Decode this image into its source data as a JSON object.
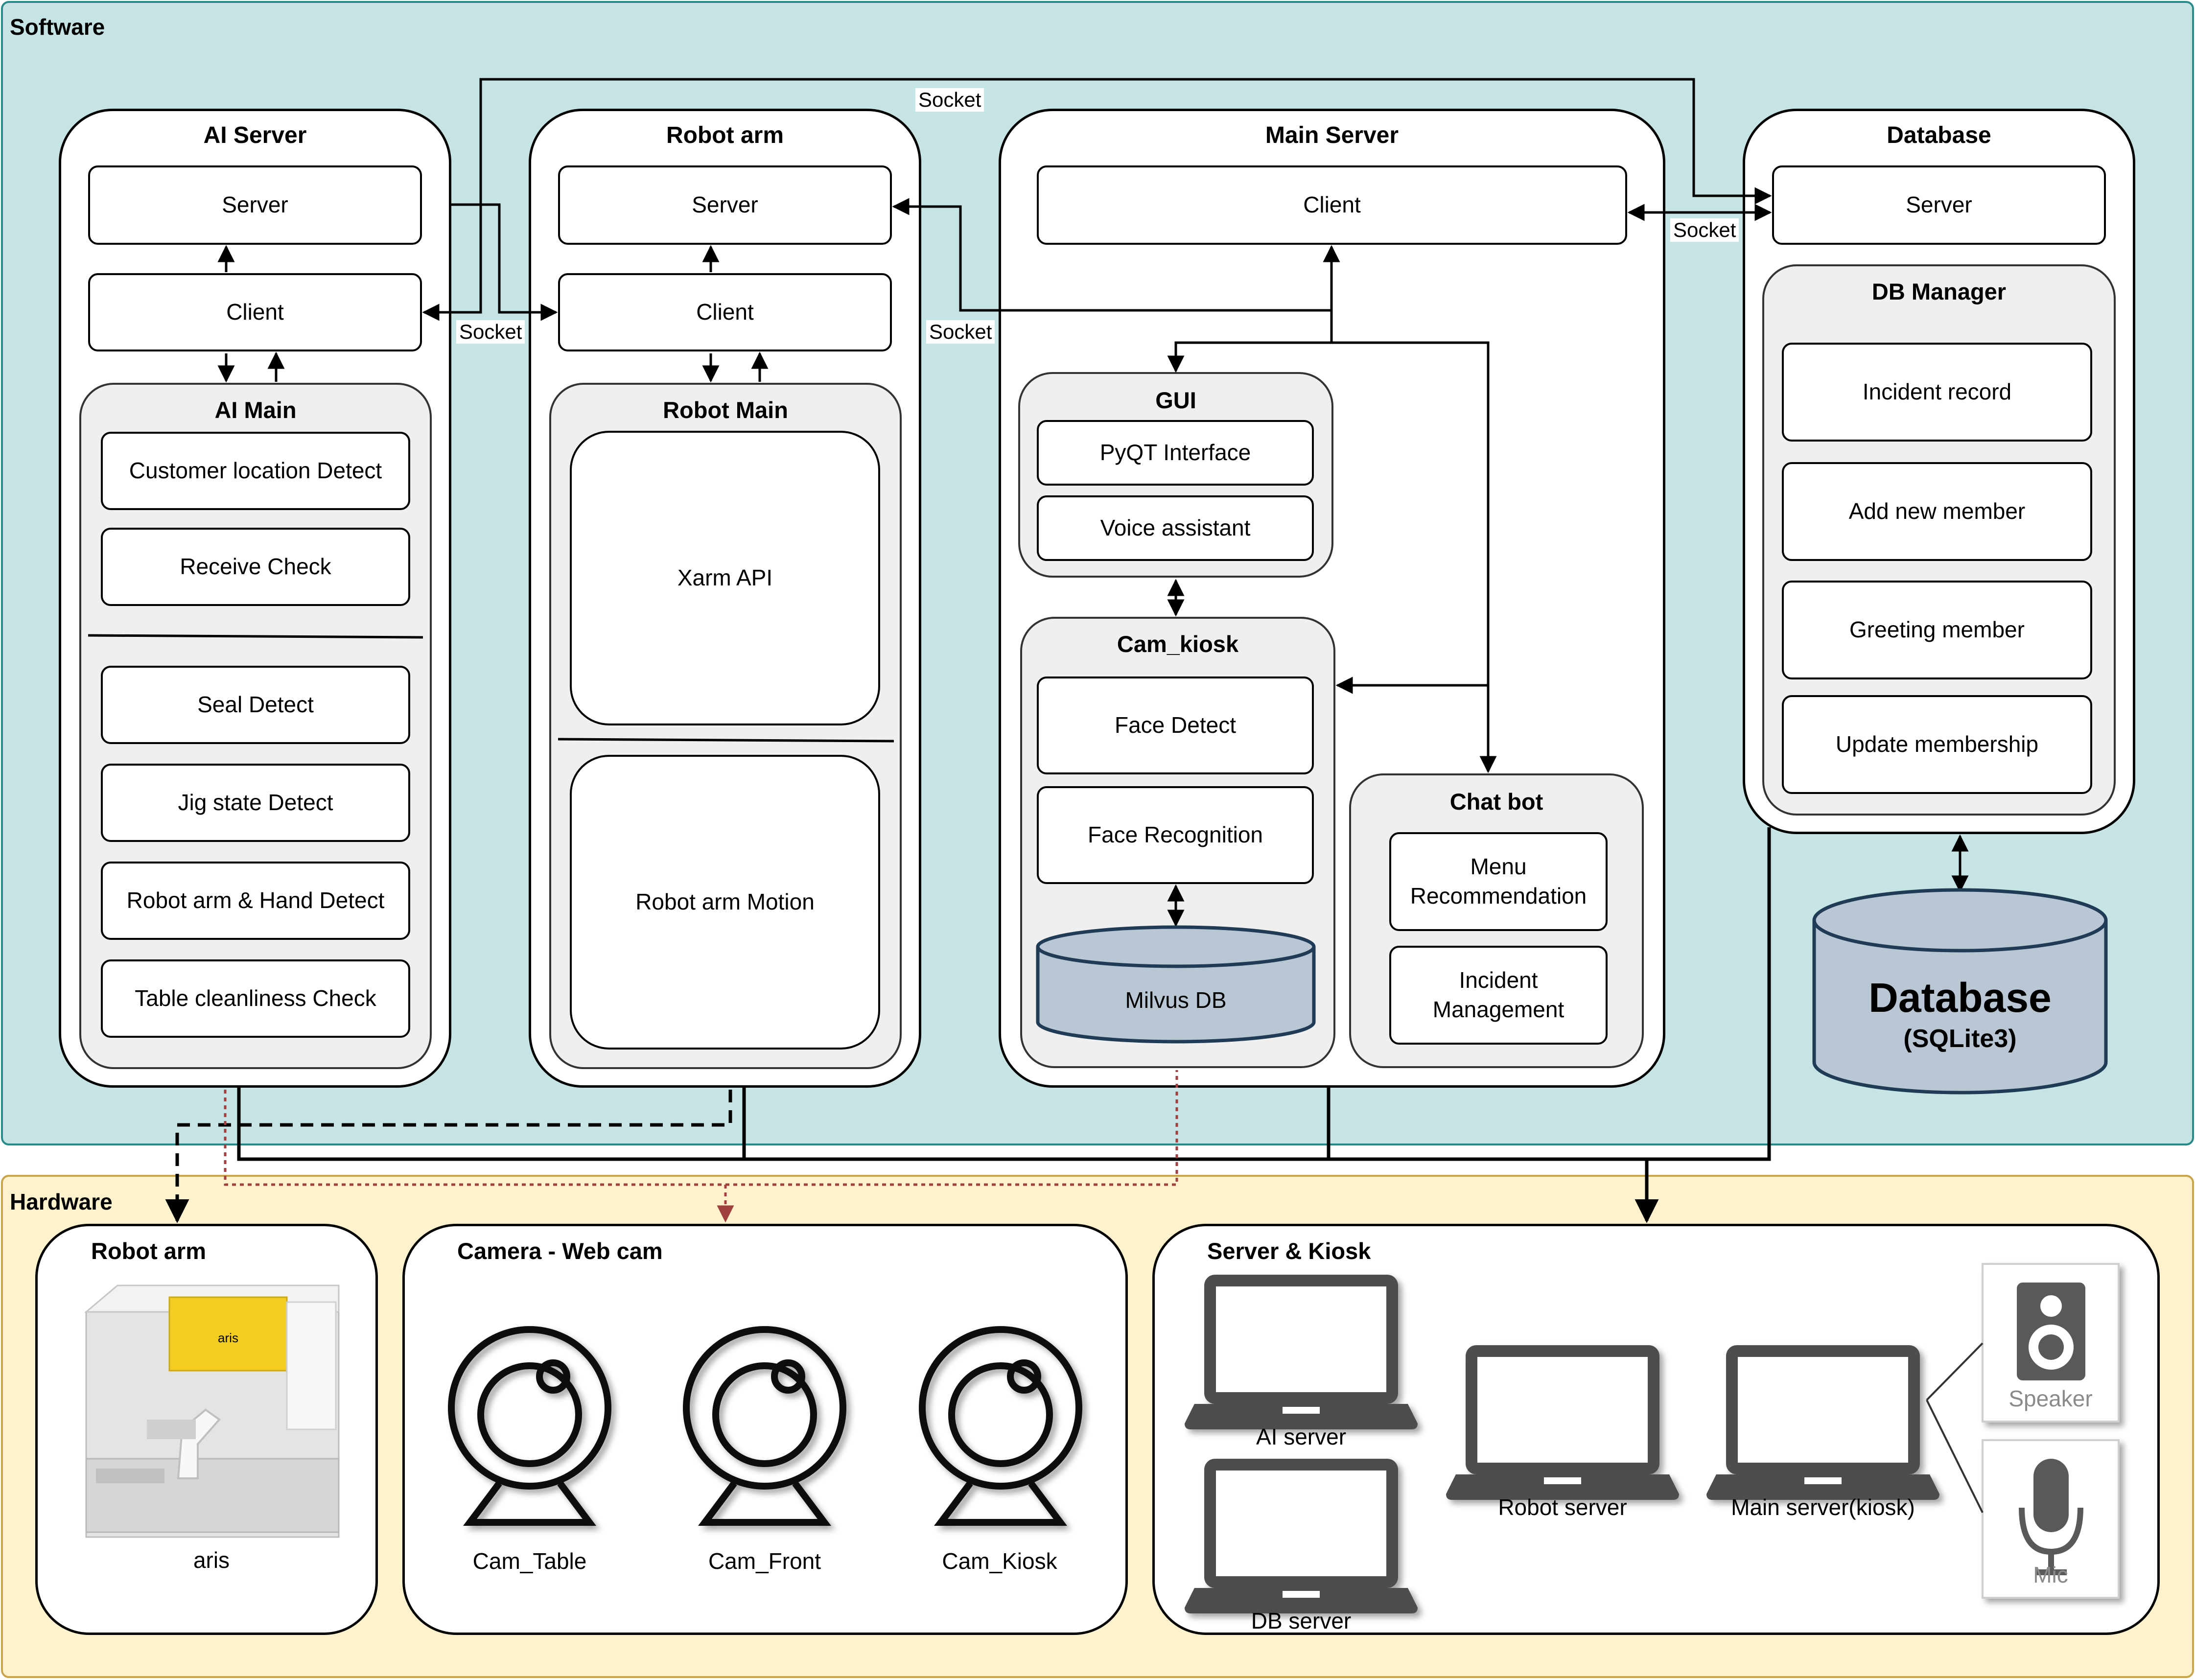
{
  "lanes": {
    "software": "Software",
    "hardware": "Hardware"
  },
  "socket_label": "Socket",
  "ai_server": {
    "title": "AI Server",
    "server": "Server",
    "client": "Client",
    "main_title": "AI Main",
    "items": [
      "Customer location Detect",
      "Receive Check",
      "Seal Detect",
      "Jig state Detect",
      "Robot arm & Hand Detect",
      "Table cleanliness Check"
    ]
  },
  "robot_arm": {
    "title": "Robot arm",
    "server": "Server",
    "client": "Client",
    "main_title": "Robot Main",
    "items": [
      "Xarm API",
      "Robot arm Motion"
    ]
  },
  "main_server": {
    "title": "Main Server",
    "client": "Client",
    "gui_title": "GUI",
    "gui_items": [
      "PyQT Interface",
      "Voice assistant"
    ],
    "cam_title": "Cam_kiosk",
    "cam_items": [
      "Face Detect",
      "Face Recognition"
    ],
    "milvus": "Milvus DB",
    "chatbot_title": "Chat bot",
    "chatbot_items": [
      "Menu Recommendation",
      "Incident Management"
    ]
  },
  "database": {
    "title": "Database",
    "server": "Server",
    "manager_title": "DB Manager",
    "items": [
      "Incident record",
      "Add new member",
      "Greeting member",
      "Update membership"
    ],
    "cylinder_title": "Database",
    "cylinder_sub": "(SQLite3)"
  },
  "hardware": {
    "robot": {
      "title": "Robot arm",
      "label": "aris",
      "brand": "aris"
    },
    "camera": {
      "title": "Camera - Web cam",
      "labels": [
        "Cam_Table",
        "Cam_Front",
        "Cam_Kiosk"
      ]
    },
    "server": {
      "title": "Server & Kiosk",
      "labels": [
        "AI server",
        "DB server",
        "Robot server",
        "Main server(kiosk)"
      ],
      "speaker": "Speaker",
      "mic": "Mic"
    }
  },
  "colors": {
    "software_bg": "#c7e4e4",
    "hardware_bg": "#fff2cc",
    "cylinder": "#b9c7d5",
    "dotted_link": "#a04040"
  }
}
